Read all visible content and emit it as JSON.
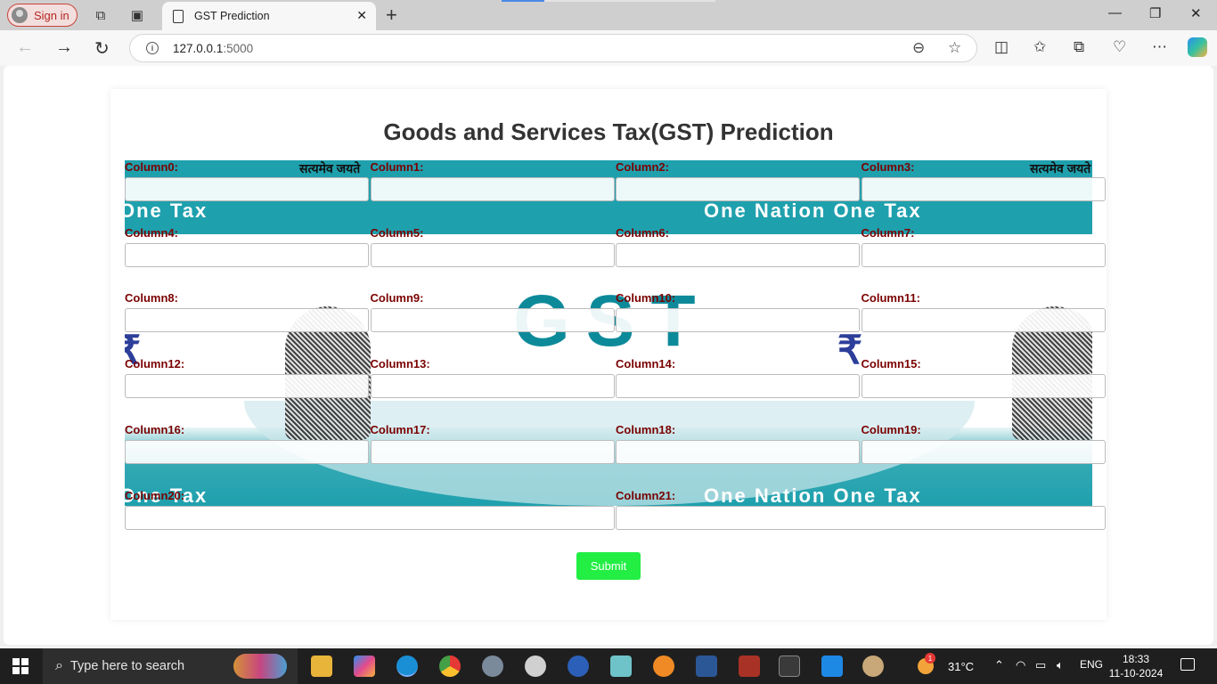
{
  "browser": {
    "signin_label": "Sign in",
    "tab_title": "GST Prediction",
    "address": {
      "host": "127.0.0.1",
      "port": ":5000"
    }
  },
  "page": {
    "title": "Goods and Services Tax(GST) Prediction",
    "banner_texts": {
      "one_tax": "One Tax",
      "one_nation_one_tax": "One Nation One Tax",
      "gst": "GST",
      "hindi": "सत्यमेव जयते"
    },
    "fields": [
      {
        "label": "Column0:",
        "value": ""
      },
      {
        "label": "Column1:",
        "value": ""
      },
      {
        "label": "Column2:",
        "value": ""
      },
      {
        "label": "Column3:",
        "value": ""
      },
      {
        "label": "Column4:",
        "value": ""
      },
      {
        "label": "Column5:",
        "value": ""
      },
      {
        "label": "Column6:",
        "value": ""
      },
      {
        "label": "Column7:",
        "value": ""
      },
      {
        "label": "Column8:",
        "value": ""
      },
      {
        "label": "Column9:",
        "value": ""
      },
      {
        "label": "Column10:",
        "value": ""
      },
      {
        "label": "Column11:",
        "value": ""
      },
      {
        "label": "Column12:",
        "value": ""
      },
      {
        "label": "Column13:",
        "value": ""
      },
      {
        "label": "Column14:",
        "value": ""
      },
      {
        "label": "Column15:",
        "value": ""
      },
      {
        "label": "Column16:",
        "value": ""
      },
      {
        "label": "Column17:",
        "value": ""
      },
      {
        "label": "Column18:",
        "value": ""
      },
      {
        "label": "Column19:",
        "value": ""
      },
      {
        "label": "Column20:",
        "value": ""
      },
      {
        "label": "Column21:",
        "value": ""
      }
    ],
    "submit_label": "Submit"
  },
  "taskbar": {
    "search_placeholder": "Type here to search",
    "weather": "31°C",
    "weather_badge": "1",
    "language": "ENG",
    "time": "18:33",
    "date": "11-10-2024"
  },
  "colors": {
    "label": "#7a0000",
    "submit": "#22ee44",
    "banner": "#1fa0ad"
  }
}
